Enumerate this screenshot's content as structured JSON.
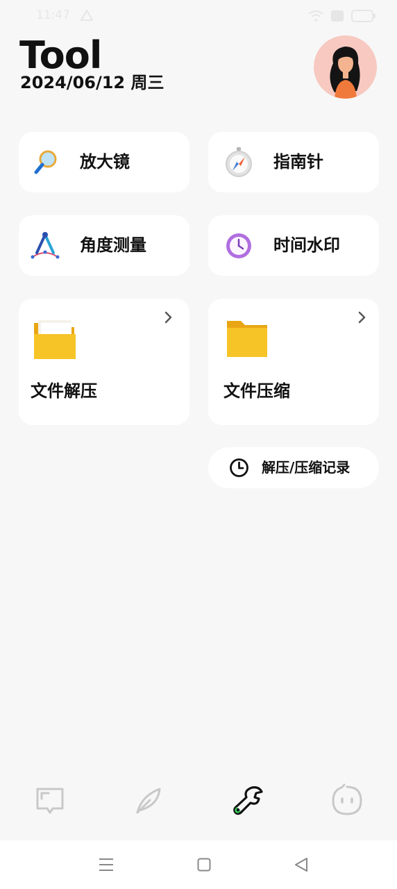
{
  "status": {
    "time": "11:47"
  },
  "header": {
    "title": "Tool",
    "date": "2024/06/12 周三"
  },
  "tools": {
    "magnifier": "放大镜",
    "compass": "指南针",
    "angle": "角度测量",
    "watermark": "时间水印",
    "unzip": "文件解压",
    "zip": "文件压缩"
  },
  "record": {
    "label": "解压/压缩记录"
  },
  "tabs": [
    {
      "icon": "book-icon",
      "active": false
    },
    {
      "icon": "feather-icon",
      "active": false
    },
    {
      "icon": "wrench-icon",
      "active": true
    },
    {
      "icon": "face-icon",
      "active": false
    }
  ],
  "colors": {
    "background": "#f7f7f7",
    "card": "#ffffff",
    "folder": "#f5c023",
    "accent_green": "#35c759",
    "avatar_bg": "#f7c9c0"
  }
}
